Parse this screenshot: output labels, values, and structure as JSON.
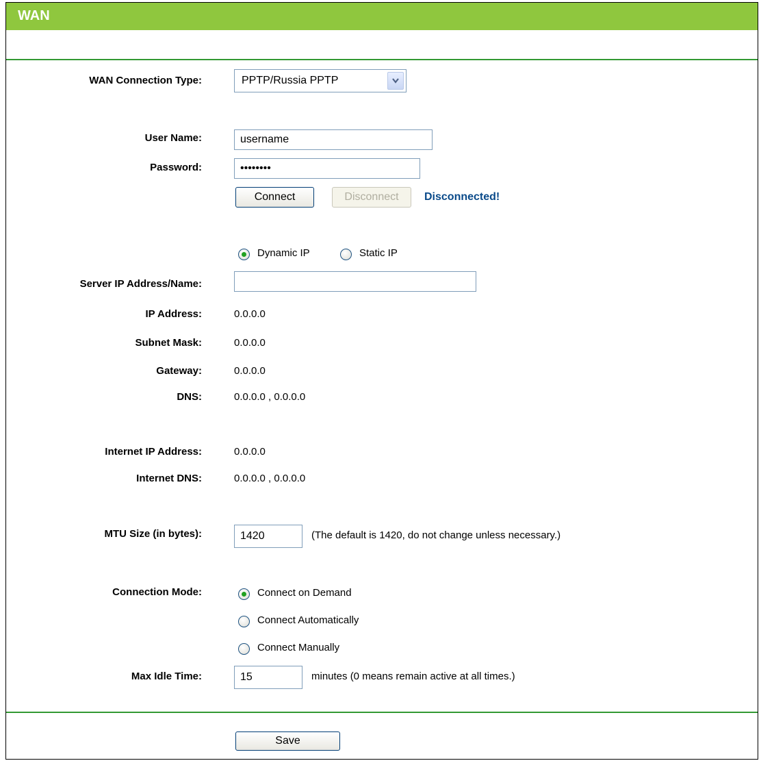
{
  "page": {
    "title": "WAN"
  },
  "colors": {
    "header": "#8fc73e",
    "divider": "#339933",
    "status": "#0a4a8a",
    "radio_dot": "#21a121"
  },
  "wan": {
    "connection_type_label": "WAN Connection Type:",
    "connection_type_value": "PPTP/Russia PPTP",
    "username_label": "User Name:",
    "username_value": "username",
    "password_label": "Password:",
    "password_value": "password",
    "connect_label": "Connect",
    "disconnect_label": "Disconnect",
    "status": "Disconnected!",
    "ip_mode": {
      "dynamic_label": "Dynamic IP",
      "static_label": "Static IP",
      "selected": "dynamic"
    },
    "server_label": "Server IP Address/Name:",
    "server_value": "",
    "ip_address_label": "IP Address:",
    "ip_address": "0.0.0.0",
    "subnet_mask_label": "Subnet Mask:",
    "subnet_mask": "0.0.0.0",
    "gateway_label": "Gateway:",
    "gateway": "0.0.0.0",
    "dns_label": "DNS:",
    "dns": "0.0.0.0 , 0.0.0.0",
    "internet_ip_label": "Internet IP Address:",
    "internet_ip": "0.0.0.0",
    "internet_dns_label": "Internet DNS:",
    "internet_dns": "0.0.0.0 , 0.0.0.0",
    "mtu_label": "MTU Size (in bytes):",
    "mtu_value": "1420",
    "mtu_note": "(The default is 1420, do not change unless necessary.)",
    "connection_mode_label": "Connection Mode:",
    "connection_mode_options": [
      "Connect on Demand",
      "Connect Automatically",
      "Connect Manually"
    ],
    "connection_mode_selected": 0,
    "max_idle_label": "Max Idle Time:",
    "max_idle_value": "15",
    "max_idle_note": "minutes (0 means remain active at all times.)",
    "save_label": "Save"
  }
}
